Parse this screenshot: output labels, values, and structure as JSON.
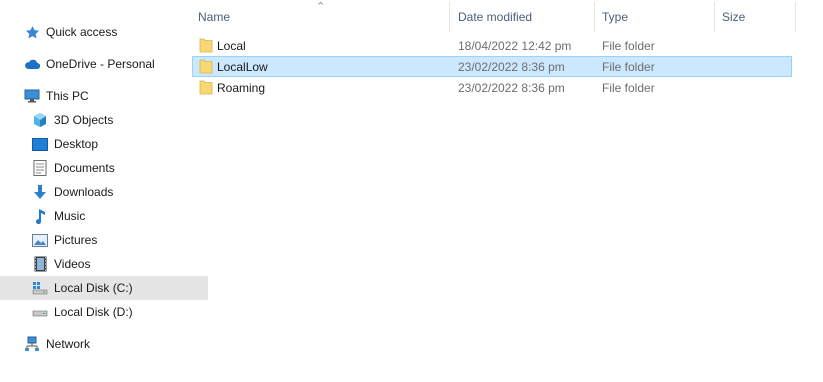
{
  "sidebar": {
    "items": [
      {
        "label": "Quick access",
        "icon": "star-icon"
      },
      {
        "label": "OneDrive - Personal",
        "icon": "cloud-icon"
      },
      {
        "label": "This PC",
        "icon": "computer-icon"
      },
      {
        "label": "3D Objects",
        "icon": "cube-icon"
      },
      {
        "label": "Desktop",
        "icon": "desktop-icon"
      },
      {
        "label": "Documents",
        "icon": "document-icon"
      },
      {
        "label": "Downloads",
        "icon": "download-arrow-icon"
      },
      {
        "label": "Music",
        "icon": "music-note-icon"
      },
      {
        "label": "Pictures",
        "icon": "picture-icon"
      },
      {
        "label": "Videos",
        "icon": "film-icon"
      },
      {
        "label": "Local Disk (C:)",
        "icon": "windows-drive-icon",
        "selected": true
      },
      {
        "label": "Local Disk (D:)",
        "icon": "drive-icon"
      },
      {
        "label": "Network",
        "icon": "network-icon"
      }
    ]
  },
  "columns": {
    "name": "Name",
    "date_modified": "Date modified",
    "type": "Type",
    "size": "Size"
  },
  "files": [
    {
      "name": "Local",
      "date": "18/04/2022 12:42 pm",
      "type": "File folder",
      "selected": false
    },
    {
      "name": "LocalLow",
      "date": "23/02/2022 8:36 pm",
      "type": "File folder",
      "selected": true
    },
    {
      "name": "Roaming",
      "date": "23/02/2022 8:36 pm",
      "type": "File folder",
      "selected": false
    }
  ],
  "colors": {
    "selection_bg": "#cce8ff",
    "selection_border": "#99d1ff",
    "sidebar_selected_bg": "#e5e5e5",
    "folder": "#f8d775"
  }
}
